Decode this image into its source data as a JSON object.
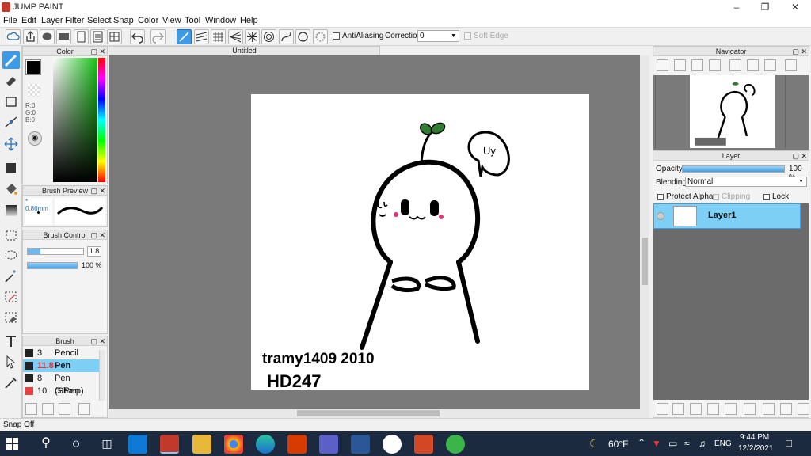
{
  "app": {
    "title": "JUMP PAINT",
    "document_tab": "Untitled"
  },
  "menu": [
    "File",
    "Edit",
    "Layer",
    "Filter",
    "Select",
    "Snap",
    "Color",
    "View",
    "Tool",
    "Window",
    "Help"
  ],
  "toolbar": {
    "antialiasing_label": "AntiAliasing",
    "correction_label": "Correction",
    "correction_value": "0",
    "soft_edge_label": "Soft Edge"
  },
  "color_panel": {
    "title": "Color",
    "r": "R:0",
    "g": "G:0",
    "b": "B:0",
    "fg": "#000000"
  },
  "brush_preview": {
    "title": "Brush Preview",
    "size": "0.86mm"
  },
  "brush_control": {
    "title": "Brush Control",
    "size_value": "1.8",
    "opacity_value": "100 %"
  },
  "brush": {
    "title": "Brush",
    "items": [
      {
        "size": "3",
        "name": "Pencil",
        "color": "#222222"
      },
      {
        "size": "11.8",
        "name": "Pen",
        "color": "#222222",
        "selected": true
      },
      {
        "size": "8",
        "name": "Pen (Sharp)",
        "color": "#222222"
      },
      {
        "size": "10",
        "name": "G Pen",
        "color": "#e84040"
      }
    ]
  },
  "artwork": {
    "speech": "Uy",
    "signature_line1": "tramy1409 2010",
    "signature_line2": "HD247"
  },
  "navigator": {
    "title": "Navigator"
  },
  "layer_panel": {
    "title": "Layer",
    "opacity_label": "Opacity",
    "opacity_value": "100 %",
    "blending_label": "Blending",
    "blending_value": "Normal",
    "protect_alpha": "Protect Alpha",
    "clipping": "Clipping",
    "lock": "Lock",
    "layers": [
      {
        "name": "Layer1"
      }
    ]
  },
  "status": {
    "text": "Snap Off"
  },
  "taskbar": {
    "weather": "60°F",
    "language": "ENG",
    "time": "9:44 PM",
    "date": "12/2/2021"
  },
  "colors": {
    "accent": "#3b9be8",
    "canvas_bg": "#7a7a7a",
    "taskbar": "#1b2a3e",
    "selection": "#7ecff5"
  }
}
